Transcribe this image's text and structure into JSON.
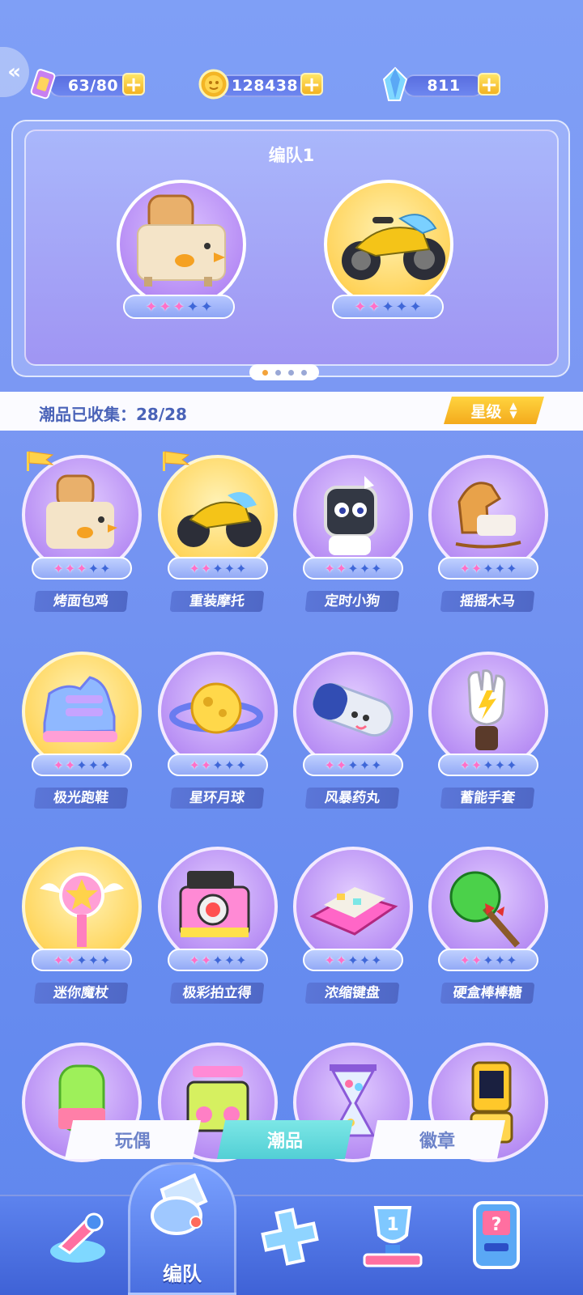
{
  "resources": {
    "stamina": "63/80",
    "coins": "128438",
    "gems": "811"
  },
  "team": {
    "title": "编队1",
    "slots": [
      {
        "stars": 3,
        "max": 5
      },
      {
        "stars": 2,
        "max": 5
      }
    ],
    "page_index": 1,
    "page_count": 4
  },
  "collection": {
    "label": "潮品已收集：28/28",
    "sort_label": "星级"
  },
  "items": [
    {
      "name": "烤面包鸡",
      "stars": 3,
      "gold": false,
      "flag": true
    },
    {
      "name": "重装摩托",
      "stars": 2,
      "gold": true,
      "flag": true
    },
    {
      "name": "定时小狗",
      "stars": 2,
      "gold": false,
      "flag": false
    },
    {
      "name": "摇摇木马",
      "stars": 2,
      "gold": false,
      "flag": false
    },
    {
      "name": "极光跑鞋",
      "stars": 2,
      "gold": true,
      "flag": false
    },
    {
      "name": "星环月球",
      "stars": 2,
      "gold": false,
      "flag": false
    },
    {
      "name": "风暴药丸",
      "stars": 2,
      "gold": false,
      "flag": false
    },
    {
      "name": "蓄能手套",
      "stars": 2,
      "gold": false,
      "flag": false
    },
    {
      "name": "迷你魔杖",
      "stars": 2,
      "gold": true,
      "flag": false
    },
    {
      "name": "极彩拍立得",
      "stars": 2,
      "gold": false,
      "flag": false
    },
    {
      "name": "浓缩键盘",
      "stars": 2,
      "gold": false,
      "flag": false
    },
    {
      "name": "硬盒棒棒糖",
      "stars": 2,
      "gold": false,
      "flag": false
    }
  ],
  "tabs": [
    "玩偶",
    "潮品",
    "徽章"
  ],
  "active_tab": "潮品",
  "nav": {
    "center_label": "编队"
  }
}
